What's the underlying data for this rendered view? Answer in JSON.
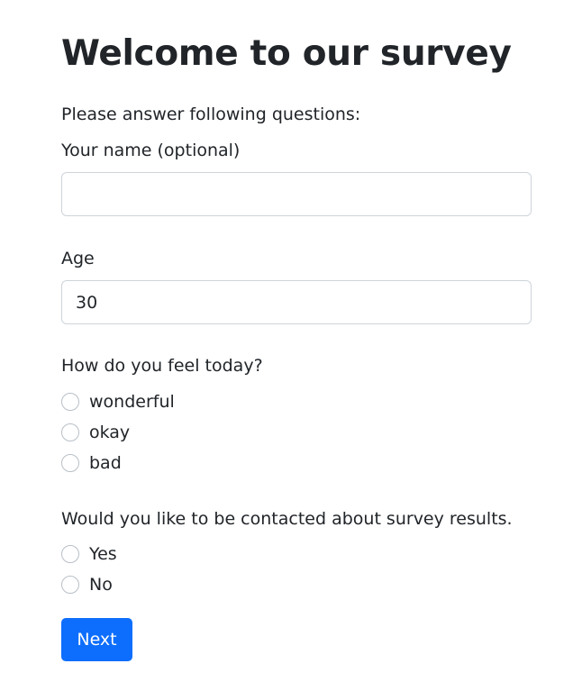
{
  "page": {
    "title": "Welcome to our survey",
    "intro": "Please answer following questions:"
  },
  "fields": {
    "name": {
      "label": "Your name (optional)",
      "value": "",
      "placeholder": ""
    },
    "age": {
      "label": "Age",
      "value": "30"
    }
  },
  "feel": {
    "question": "How do you feel today?",
    "options": [
      "wonderful",
      "okay",
      "bad"
    ],
    "selected": null
  },
  "contact": {
    "question": "Would you like to be contacted about survey results.",
    "options": [
      "Yes",
      "No"
    ],
    "selected": null
  },
  "actions": {
    "next_label": "Next"
  },
  "colors": {
    "primary": "#0d6efd",
    "text": "#212529",
    "border": "#ced4da"
  }
}
